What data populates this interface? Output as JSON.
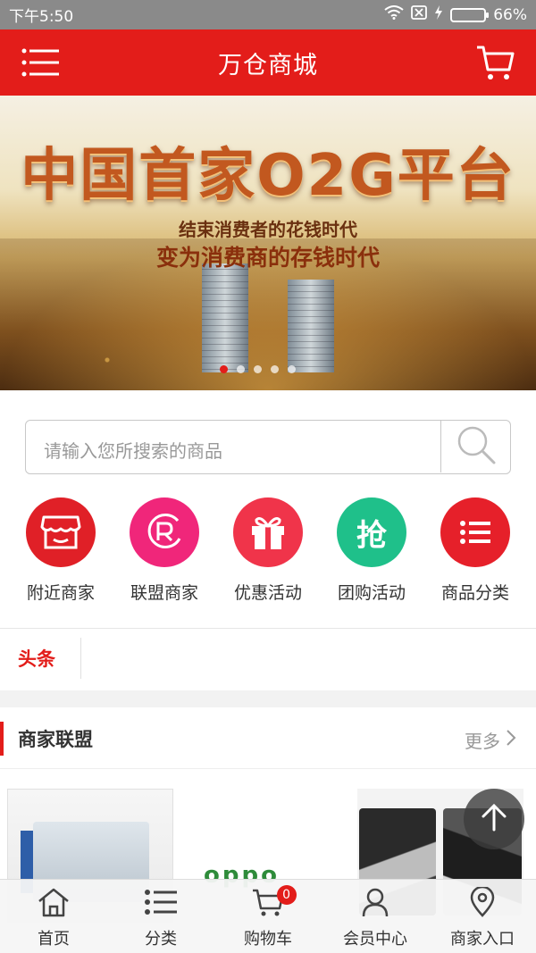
{
  "status_bar": {
    "time": "下午5:50",
    "battery": "66%",
    "battery_level": 0.66
  },
  "header": {
    "title": "万仓商城",
    "menu_icon": "hamburger-menu-icon",
    "cart_icon": "shopping-cart-icon"
  },
  "banner": {
    "headline": "中国首家O2G平台",
    "subline1": "结束消费者的花钱时代",
    "subline2": "变为消费商的存钱时代",
    "slide_count": 5,
    "active_slide": 1
  },
  "search": {
    "placeholder": "请输入您所搜索的商品",
    "button_icon": "search-icon"
  },
  "quick_links": [
    {
      "label": "附近商家",
      "icon": "store-icon",
      "color": "#e02027"
    },
    {
      "label": "联盟商家",
      "icon": "registered-icon",
      "color": "#f0267a"
    },
    {
      "label": "优惠活动",
      "icon": "gift-icon",
      "color": "#f0344a"
    },
    {
      "label": "团购活动",
      "icon": "grab-icon",
      "icon_text": "抢",
      "color": "#1fc08a"
    },
    {
      "label": "商品分类",
      "icon": "list-icon",
      "color": "#e6202a"
    }
  ],
  "headline_label": "头条",
  "section": {
    "title": "商家联盟",
    "more": "更多"
  },
  "cards": [
    {
      "name": "machine"
    },
    {
      "name": "oppo",
      "logo_text": "oppo"
    },
    {
      "name": "shoes"
    }
  ],
  "tabbar": [
    {
      "label": "首页",
      "icon": "home-icon"
    },
    {
      "label": "分类",
      "icon": "category-list-icon"
    },
    {
      "label": "购物车",
      "icon": "cart-icon",
      "badge": "0"
    },
    {
      "label": "会员中心",
      "icon": "user-icon"
    },
    {
      "label": "商家入口",
      "icon": "location-pin-icon"
    }
  ],
  "colors": {
    "brand_red": "#e31d1a",
    "status_bar": "#8a8a8a"
  }
}
